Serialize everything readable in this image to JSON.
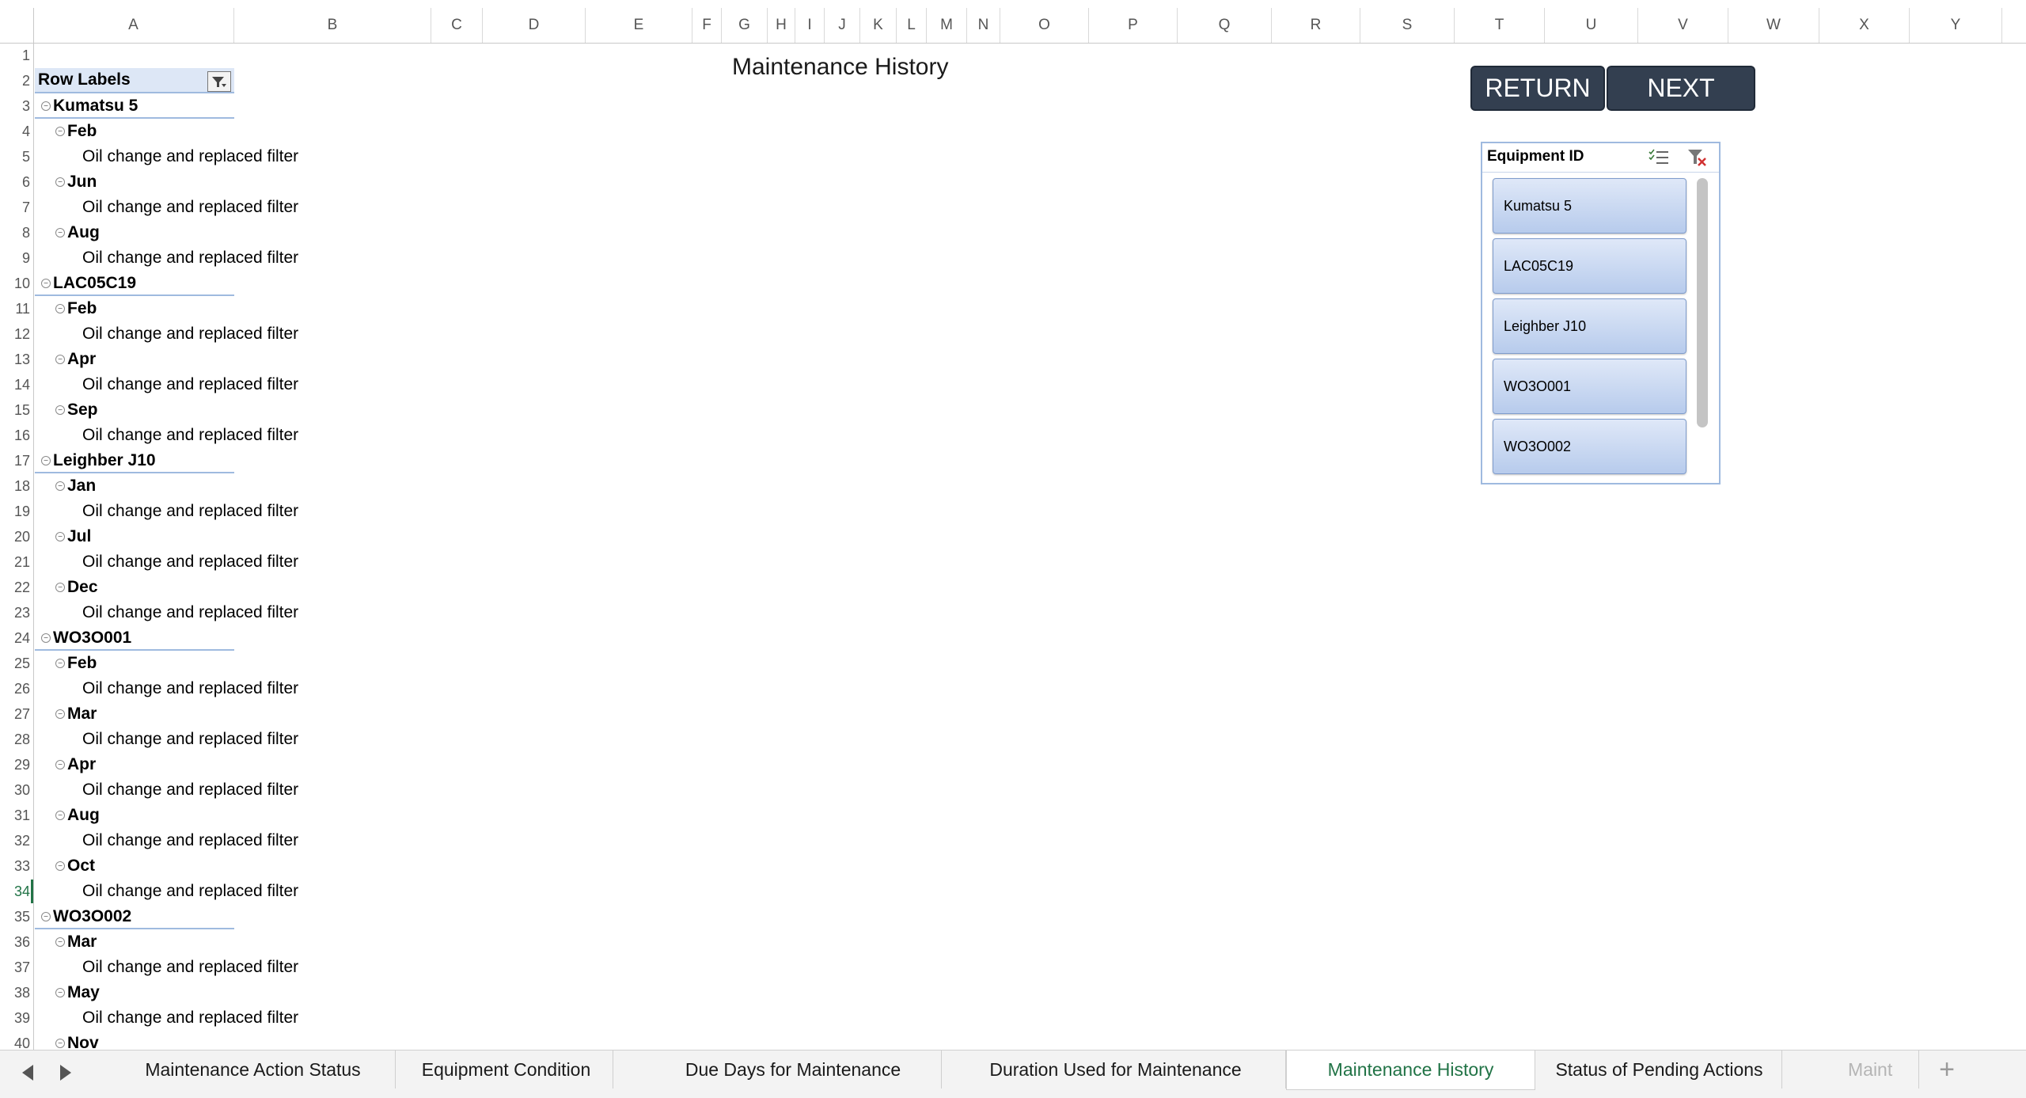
{
  "columns": [
    "A",
    "B",
    "C",
    "D",
    "E",
    "F",
    "G",
    "H",
    "I",
    "J",
    "K",
    "L",
    "M",
    "N",
    "O",
    "P",
    "Q",
    "R",
    "S",
    "T",
    "U",
    "V",
    "W",
    "X",
    "Y"
  ],
  "row_numbers": [
    "1",
    "2",
    "3",
    "4",
    "5",
    "6",
    "7",
    "8",
    "9",
    "10",
    "11",
    "12",
    "13",
    "14",
    "15",
    "16",
    "17",
    "18",
    "19",
    "20",
    "21",
    "22",
    "23",
    "24",
    "25",
    "26",
    "27",
    "28",
    "29",
    "30",
    "31",
    "32",
    "33",
    "34",
    "35",
    "36",
    "37",
    "38",
    "39",
    "40"
  ],
  "title": "Maintenance History",
  "pivot": {
    "header": "Row Labels",
    "detail": "Oil change and replaced filter",
    "groups": [
      {
        "name": "Kumatsu 5",
        "months": [
          "Feb",
          "Jun",
          "Aug"
        ]
      },
      {
        "name": "LAC05C19",
        "months": [
          "Feb",
          "Apr",
          "Sep"
        ]
      },
      {
        "name": "Leighber J10",
        "months": [
          "Jan",
          "Jul",
          "Dec"
        ]
      },
      {
        "name": "WO3O001",
        "months": [
          "Feb",
          "Mar",
          "Apr",
          "Aug",
          "Oct"
        ]
      },
      {
        "name": "WO3O002",
        "months": [
          "Mar",
          "May",
          "Nov"
        ]
      }
    ]
  },
  "buttons": {
    "return": "RETURN",
    "next": "NEXT"
  },
  "slicer": {
    "title": "Equipment ID",
    "items": [
      "Kumatsu 5",
      "LAC05C19",
      "Leighber J10",
      "WO3O001",
      "WO3O002"
    ]
  },
  "tabs": {
    "items": [
      "Maintenance Action Status",
      "Equipment Condition",
      "Due Days for Maintenance",
      "Duration Used for Maintenance",
      "Maintenance History",
      "Status of Pending Actions",
      "Maint"
    ],
    "active": "Maintenance History",
    "add": "+"
  },
  "colors": {
    "accent": "#217346",
    "button": "#333f50",
    "pivot_header": "#dde7f6",
    "slicer_item": "#b7cbec"
  }
}
